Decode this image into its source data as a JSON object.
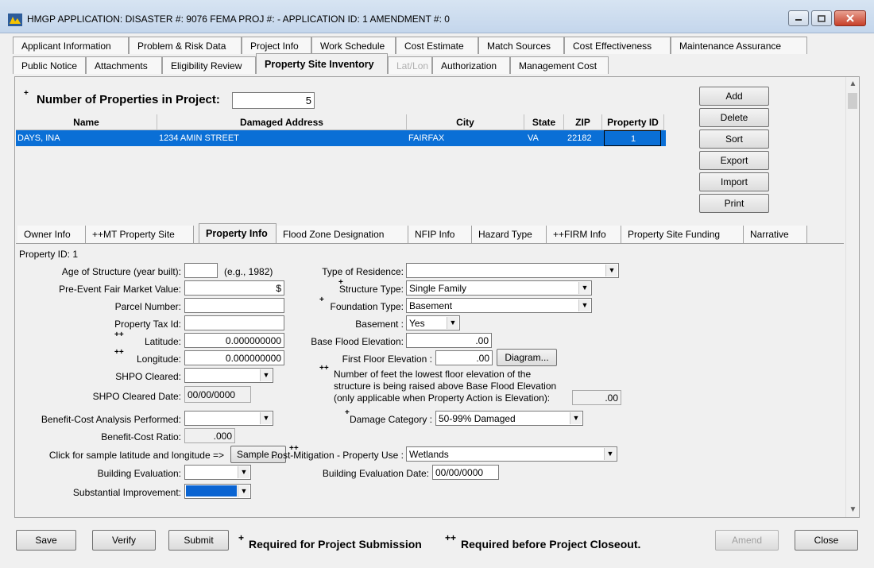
{
  "window": {
    "title": "HMGP APPLICATION:  DISASTER #: 9076  FEMA PROJ #:  -    APPLICATION ID: 1  AMENDMENT #: 0"
  },
  "tabs_row1": [
    "Applicant Information",
    "Problem & Risk Data",
    "Project Info",
    "Work Schedule",
    "Cost Estimate",
    "Match Sources",
    "Cost Effectiveness",
    "Maintenance Assurance"
  ],
  "tabs_row2": [
    "Public Notice",
    "Attachments",
    "Eligibility Review",
    "Property Site Inventory",
    "Lat/Lon",
    "Authorization",
    "Management Cost"
  ],
  "properties": {
    "count_label": "Number of Properties in Project:",
    "count_value": "5",
    "required_mark": "+",
    "columns": [
      "Name",
      "Damaged Address",
      "City",
      "State",
      "ZIP",
      "Property ID"
    ],
    "rows": [
      {
        "name": "DAYS, INA",
        "address": "1234 AMIN STREET",
        "city": "FAIRFAX",
        "state": "VA",
        "zip": "22182",
        "property_id": "1"
      }
    ],
    "buttons": [
      "Add",
      "Delete",
      "Sort",
      "Export",
      "Import",
      "Print"
    ]
  },
  "subtabs": [
    "Owner Info",
    "++MT Property Site",
    "Property Info",
    "Flood Zone Designation",
    "NFIP Info",
    "Hazard Type",
    "++FIRM Info",
    "Property Site Funding",
    "Narrative"
  ],
  "form": {
    "property_id": "Property ID:  1",
    "age_label": "Age of Structure (year built):",
    "age_hint": "(e.g., 1982)",
    "fair_market_label": "Pre-Event Fair Market Value:",
    "fair_market_value": "$",
    "parcel_label": "Parcel Number:",
    "tax_label": "Property Tax Id:",
    "latitude_label": "Latitude:",
    "latitude_value": "0.000000000",
    "longitude_label": "Longitude:",
    "longitude_value": "0.000000000",
    "shpo_label": "SHPO Cleared:",
    "shpo_date_label": "SHPO Cleared Date:",
    "shpo_date_value": "00/00/0000",
    "bca_label": "Benefit-Cost Analysis Performed:",
    "bcr_label": "Benefit-Cost Ratio:",
    "bcr_value": ".000",
    "sample_label": "Click for sample latitude and longitude =>",
    "sample_button": "Sample ...",
    "building_eval_label": "Building Evaluation:",
    "substantial_label": "Substantial Improvement:",
    "residence_label": "Type of Residence:",
    "structure_label": "Structure Type:",
    "structure_value": "Single Family",
    "foundation_label": "Foundation Type:",
    "foundation_value": "Basement",
    "basement_label": "Basement :",
    "basement_value": "Yes",
    "bfe_label": "Base Flood Elevation:",
    "bfe_value": ".00",
    "ffe_label": "First Floor Elevation :",
    "ffe_value": ".00",
    "diagram_button": "Diagram...",
    "raised_note_1": "Number of feet the lowest floor elevation of the",
    "raised_note_2": "structure is being raised above Base Flood Elevation",
    "raised_note_3": "(only applicable when Property Action is Elevation):",
    "raised_value": ".00",
    "damage_label": "Damage Category :",
    "damage_value": "50-99% Damaged",
    "post_use_label": "Post-Mitigation - Property Use :",
    "post_use_value": "Wetlands",
    "building_eval_date_label": "Building Evaluation Date:",
    "building_eval_date_value": "00/00/0000",
    "plus": "+",
    "plusplus": "++"
  },
  "footer": {
    "save": "Save",
    "verify": "Verify",
    "submit": "Submit",
    "legend_required": "Required for Project Submission",
    "legend_closeout": "Required before Project Closeout.",
    "amend": "Amend",
    "close": "Close"
  }
}
